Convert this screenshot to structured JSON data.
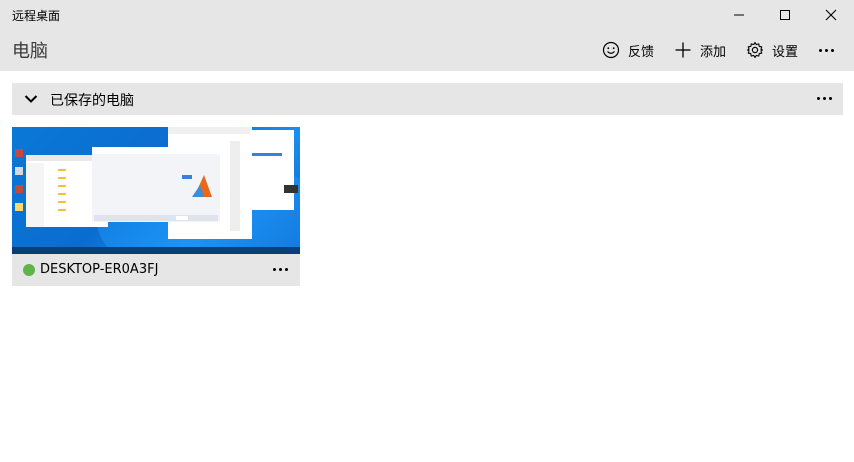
{
  "window": {
    "title": "远程桌面",
    "controls": [
      "minimize-icon",
      "maximize-icon",
      "close-icon"
    ]
  },
  "header": {
    "page_title": "电脑",
    "actions": [
      {
        "label": "反馈",
        "icon": "smiley-icon"
      },
      {
        "label": "添加",
        "icon": "plus-icon"
      },
      {
        "label": "设置",
        "icon": "gear-icon"
      }
    ],
    "more_icon": "ellipsis-icon"
  },
  "section": {
    "title": "已保存的电脑",
    "expanded": true
  },
  "pcs": [
    {
      "name": "DESKTOP-ER0A3FJ",
      "status_color": "#5fb34a"
    }
  ],
  "colors": {
    "chrome": "#e6e6e6",
    "background": "#ffffff",
    "status_online": "#5fb34a",
    "thumbnail_desktop": "#0a78d6"
  }
}
